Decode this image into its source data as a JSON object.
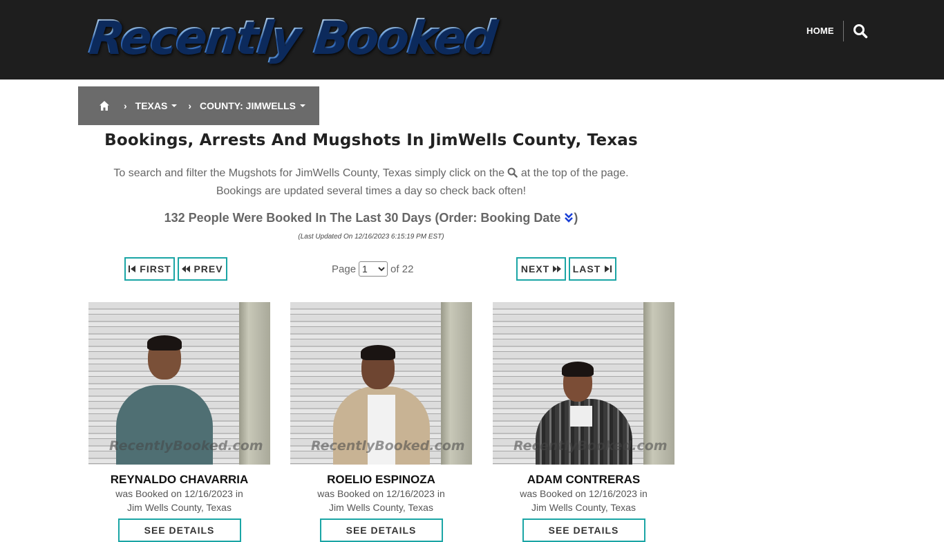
{
  "header": {
    "logo_text": "Recently Booked",
    "nav_home": "HOME",
    "search_icon": "search-icon"
  },
  "breadcrumb": {
    "home_icon": "home-icon",
    "items": [
      "TEXAS",
      "COUNTY: JIMWELLS"
    ]
  },
  "main": {
    "title": "Bookings, Arrests And Mugshots In JimWells County, Texas",
    "desc_part1": "To search and filter the Mugshots for JimWells County, Texas simply click on the",
    "desc_part2": "at the top of the page.",
    "desc_line2": "Bookings are updated several times a day so check back often!",
    "count_text": "132 People Were Booked In The Last 30 Days (Order: Booking Date",
    "count_close": ")",
    "updated": "(Last Updated On 12/16/2023 6:15:19 PM EST)"
  },
  "pagination": {
    "first": "FIRST",
    "prev": "PREV",
    "next": "NEXT",
    "last": "LAST",
    "page_label": "Page",
    "current_page": "1",
    "of_label": "of 22"
  },
  "bookings": [
    {
      "name": "REYNALDO CHAVARRIA",
      "booked_line": "was Booked on 12/16/2023 in",
      "location": "Jim Wells County, Texas",
      "button": "SEE DETAILS",
      "watermark": "RecentlyBooked.com"
    },
    {
      "name": "ROELIO ESPINOZA",
      "booked_line": "was Booked on 12/16/2023 in",
      "location": "Jim Wells County, Texas",
      "button": "SEE DETAILS",
      "watermark": "RecentlyBooked.com"
    },
    {
      "name": "ADAM CONTRERAS",
      "booked_line": "was Booked on 12/16/2023 in",
      "location": "Jim Wells County, Texas",
      "button": "SEE DETAILS",
      "watermark": "RecentlyBooked.com"
    }
  ],
  "colors": {
    "header_bg": "#1e1e1e",
    "breadcrumb_bg": "#6b6b6b",
    "button_border": "#1aa5a5",
    "order_icon": "#1a3fd6"
  }
}
